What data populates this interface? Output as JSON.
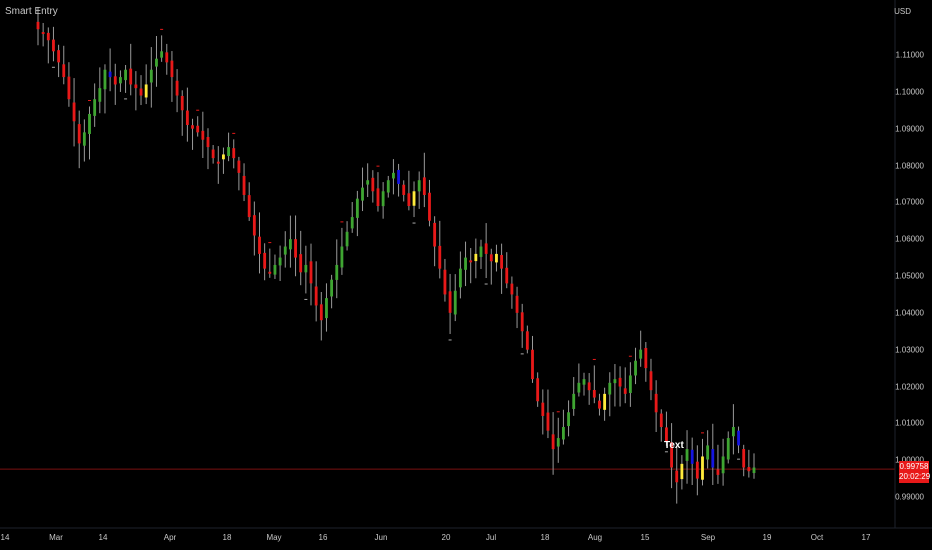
{
  "indicator": {
    "name": "Smart Entry"
  },
  "currency": "USD",
  "price_badge": {
    "price": "0.99758",
    "countdown": "20:02:29"
  },
  "chart_data": {
    "type": "candlestick",
    "title": "",
    "indicator": "Smart Entry",
    "currency": "USD",
    "ylim": [
      0.984,
      1.121
    ],
    "grid": false,
    "y_ticks": [
      "1.11000",
      "1.10000",
      "1.09000",
      "1.08000",
      "1.07000",
      "1.06000",
      "1.05000",
      "1.04000",
      "1.03000",
      "1.02000",
      "1.01000",
      "1.00000",
      "0.99000"
    ],
    "x_ticks": [
      "14",
      "Mar",
      "14",
      "Apr",
      "18",
      "May",
      "16",
      "Jun",
      "20",
      "Jul",
      "18",
      "Aug",
      "15",
      "Sep",
      "19",
      "Oct",
      "17"
    ],
    "current_price": 0.99758,
    "current_price_label": "0.99758",
    "countdown": "20:02:29",
    "annotation": "Text",
    "bar_color_legend": {
      "red": "#e81919",
      "green": "#3fa532",
      "yellow": "#ffeb3b",
      "blue": "#1515e0"
    },
    "close_series": [
      1.117,
      1.116,
      1.114,
      1.111,
      1.108,
      1.104,
      1.098,
      1.092,
      1.086,
      1.089,
      1.094,
      1.098,
      1.101,
      1.106,
      1.104,
      1.102,
      1.104,
      1.106,
      1.102,
      1.101,
      1.099,
      1.102,
      1.106,
      1.109,
      1.111,
      1.108,
      1.104,
      1.099,
      1.095,
      1.091,
      1.09,
      1.089,
      1.087,
      1.085,
      1.082,
      1.081,
      1.083,
      1.085,
      1.082,
      1.078,
      1.072,
      1.066,
      1.061,
      1.056,
      1.052,
      1.051,
      1.053,
      1.055,
      1.058,
      1.06,
      1.055,
      1.051,
      1.053,
      1.048,
      1.042,
      1.038,
      1.044,
      1.049,
      1.053,
      1.058,
      1.062,
      1.066,
      1.071,
      1.074,
      1.076,
      1.073,
      1.069,
      1.073,
      1.076,
      1.078,
      1.075,
      1.072,
      1.069,
      1.073,
      1.076,
      1.072,
      1.065,
      1.058,
      1.052,
      1.045,
      1.04,
      1.046,
      1.052,
      1.055,
      1.054,
      1.056,
      1.058,
      1.056,
      1.054,
      1.056,
      1.052,
      1.048,
      1.045,
      1.04,
      1.035,
      1.03,
      1.022,
      1.016,
      1.012,
      1.008,
      1.003,
      1.006,
      1.009,
      1.013,
      1.018,
      1.021,
      1.022,
      1.019,
      1.017,
      1.014,
      1.018,
      1.021,
      1.022,
      1.02,
      1.018,
      1.023,
      1.027,
      1.03,
      1.025,
      1.019,
      1.013,
      1.009,
      1.005,
      0.998,
      0.994,
      0.999,
      1.003,
      0.999,
      0.995,
      1.001,
      1.004,
      0.998,
      0.996,
      1.001,
      1.006,
      1.009,
      1.004,
      0.998,
      0.997,
      0.998
    ]
  }
}
